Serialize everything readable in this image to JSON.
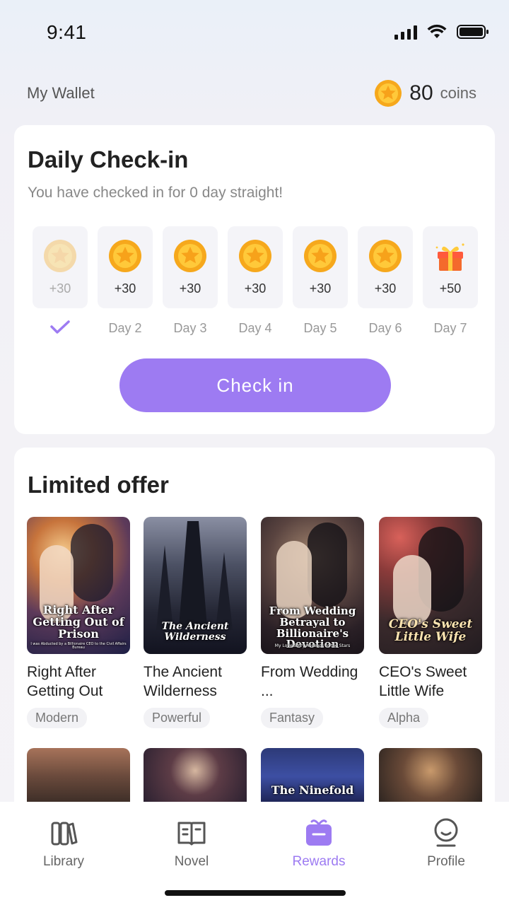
{
  "status": {
    "time": "9:41"
  },
  "wallet": {
    "label": "My Wallet",
    "coins": "80",
    "unit": "coins"
  },
  "checkin": {
    "title": "Daily Check-in",
    "subtitle": "You have checked in for 0 day straight!",
    "days": [
      {
        "amount": "+30",
        "label": "",
        "done": true,
        "icon": "coin-icon"
      },
      {
        "amount": "+30",
        "label": "Day 2",
        "icon": "coin-icon"
      },
      {
        "amount": "+30",
        "label": "Day 3",
        "icon": "coin-icon"
      },
      {
        "amount": "+30",
        "label": "Day 4",
        "icon": "coin-icon"
      },
      {
        "amount": "+30",
        "label": "Day 5",
        "icon": "coin-icon"
      },
      {
        "amount": "+30",
        "label": "Day 6",
        "icon": "coin-icon"
      },
      {
        "amount": "+50",
        "label": "Day 7",
        "icon": "gift-icon"
      }
    ],
    "button": "Check in"
  },
  "offer": {
    "title": "Limited offer",
    "books": [
      {
        "name": "Right After Getting Out",
        "tag": "Modern",
        "cover_text": "Right After Getting Out of Prison",
        "cover_sub": "I was Abducted by a Billionaire CEO to the Civil Affairs Bureau"
      },
      {
        "name": "The Ancient Wilderness",
        "tag": "Powerful",
        "cover_text": "The Ancient Wilderness",
        "cover_sub": ""
      },
      {
        "name": "From Wedding ...",
        "tag": "Fantasy",
        "cover_text": "From Wedding Betrayal to Billionaire's Devotion",
        "cover_sub": "My Love Story Ascends to the Stars"
      },
      {
        "name": "CEO's Sweet Little Wife",
        "tag": "Alpha",
        "cover_text": "CEO's Sweet Little Wife",
        "cover_sub": ""
      }
    ],
    "row2_cover_text": "The Ninefold"
  },
  "tabs": [
    {
      "label": "Library",
      "icon": "library-icon"
    },
    {
      "label": "Novel",
      "icon": "book-icon"
    },
    {
      "label": "Rewards",
      "icon": "gift-box-icon",
      "active": true
    },
    {
      "label": "Profile",
      "icon": "profile-icon"
    }
  ],
  "colors": {
    "accent": "#9d7bf2",
    "coin": "#f6a81c"
  }
}
